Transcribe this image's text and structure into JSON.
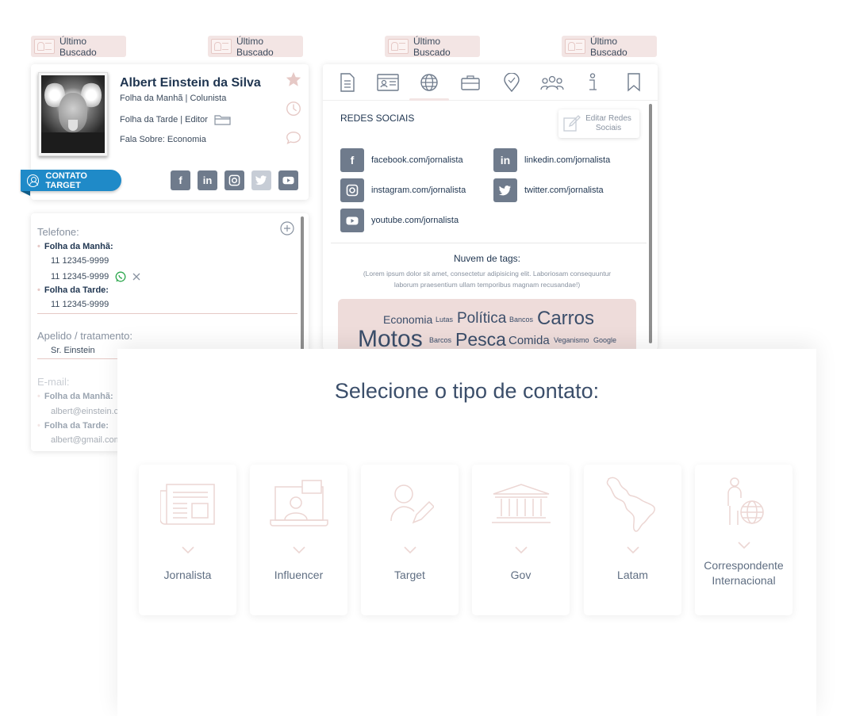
{
  "ultimo_buscado": [
    "Último Buscado",
    "Último Buscado",
    "Último Buscado",
    "Último Buscado"
  ],
  "profile": {
    "name": "Albert Einstein da Silva",
    "line1": "Folha da Manhã | Colunista",
    "line2": "Folha da Tarde | Editor",
    "line3": "Fala Sobre: Economia",
    "contato_target": "CONTATO TARGET",
    "social_icons": [
      "facebook-icon",
      "linkedin-icon",
      "instagram-icon",
      "twitter-icon",
      "youtube-icon"
    ]
  },
  "info": {
    "telefone_label": "Telefone:",
    "folha_manha": "Folha da Manhã:",
    "phone1": "11 12345-9999",
    "phone2": "11 12345-9999",
    "folha_tarde": "Folha da Tarde:",
    "phone3": "11 12345-9999",
    "apelido_label": "Apelido / tratamento:",
    "apelido_value": "Sr. Einstein",
    "email_label": "E-mail:",
    "email_manha_label": "Folha da Manhã:",
    "email_manha": "albert@einstein.c",
    "email_tarde_label": "Folha da Tarde:",
    "email_tarde": "albert@gmail.com"
  },
  "tabs": {
    "icons": [
      "document-icon",
      "id-card-icon",
      "globe-icon",
      "briefcase-icon",
      "location-pin-icon",
      "group-icon",
      "info-icon",
      "bookmark-icon"
    ],
    "active": "globe-icon",
    "redes_title": "REDES SOCIAIS",
    "edit_redes": "Editar Redes Sociais",
    "social": {
      "facebook": "facebook.com/jornalista",
      "linkedin": "linkedin.com/jornalista",
      "instagram": "instagram.com/jornalista",
      "twitter": "twitter.com/jornalista",
      "youtube": "youtube.com/jornalista"
    },
    "nuvem_title": "Nuvem de tags:",
    "nuvem_desc": "(Lorem ipsum dolor sit amet, consectetur adipisicing elit. Laboriosam consequuntur laborum praesentium ullam temporibus magnam recusandae!)",
    "tags": [
      "Economia",
      "Lutas",
      "Política",
      "Bancos",
      "Carros",
      "Motos",
      "Barcos",
      "Pesca",
      "Comida",
      "Veganismo",
      "Google"
    ]
  },
  "modal": {
    "title": "Selecione o tipo de contato:",
    "types": [
      "Jornalista",
      "Influencer",
      "Target",
      "Gov",
      "Latam",
      "Correspondente Internacional"
    ]
  },
  "colors": {
    "accent_blue": "#1f8ac8",
    "navy": "#1f3550",
    "pink": "#f3e5e4",
    "icon_gray": "#6f7b8c"
  }
}
